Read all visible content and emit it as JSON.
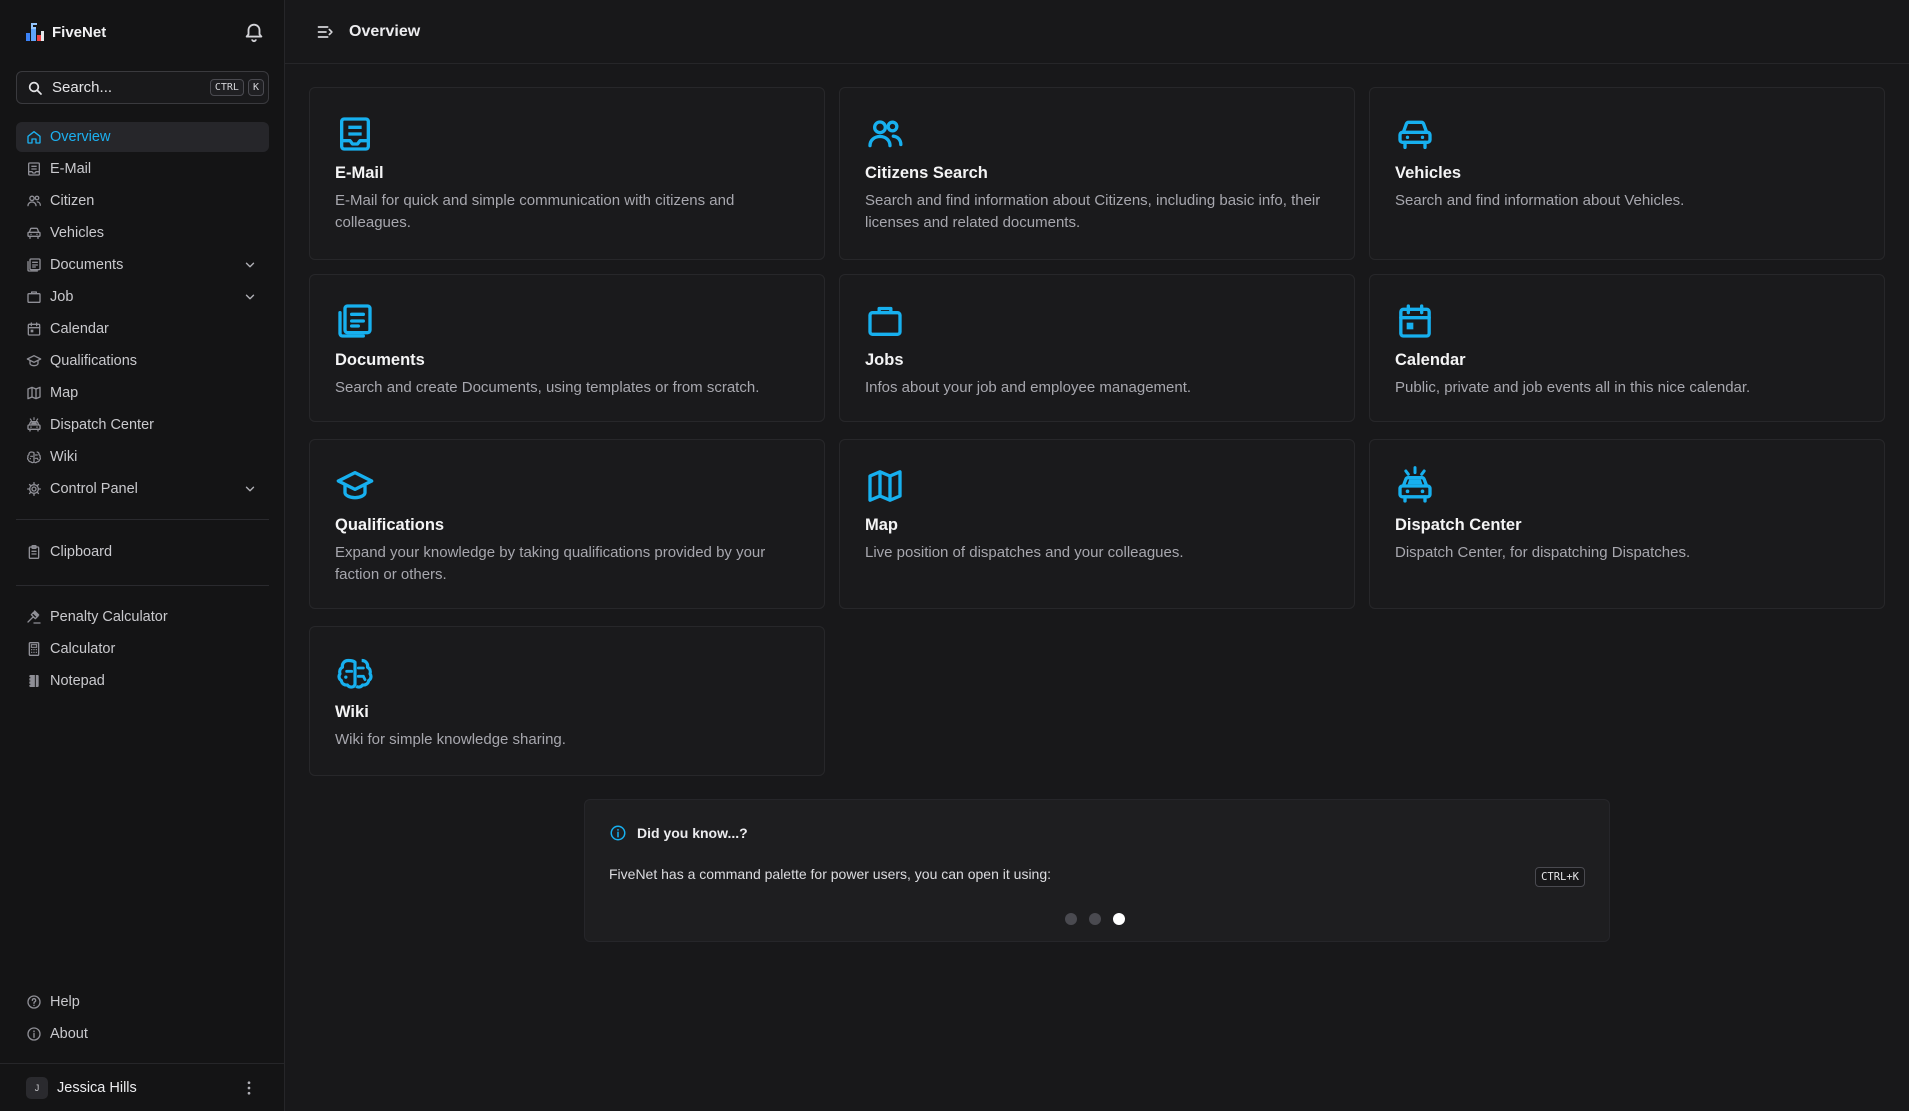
{
  "app": {
    "name": "FiveNet"
  },
  "search": {
    "placeholder": "Search...",
    "kbd_ctrl": "CTRL",
    "kbd_key": "K"
  },
  "sidebar": {
    "items": [
      {
        "label": "Overview",
        "icon": "home-icon",
        "active": true
      },
      {
        "label": "E-Mail",
        "icon": "email-icon"
      },
      {
        "label": "Citizen",
        "icon": "users-icon"
      },
      {
        "label": "Vehicles",
        "icon": "car-icon"
      },
      {
        "label": "Documents",
        "icon": "documents-icon",
        "expandable": true
      },
      {
        "label": "Job",
        "icon": "briefcase-icon",
        "expandable": true
      },
      {
        "label": "Calendar",
        "icon": "calendar-icon"
      },
      {
        "label": "Qualifications",
        "icon": "graduation-cap-icon"
      },
      {
        "label": "Map",
        "icon": "map-icon"
      },
      {
        "label": "Dispatch Center",
        "icon": "car-emergency-icon"
      },
      {
        "label": "Wiki",
        "icon": "brain-icon"
      },
      {
        "label": "Control Panel",
        "icon": "gear-icon",
        "expandable": true
      }
    ],
    "clipboard": {
      "label": "Clipboard",
      "icon": "clipboard-icon"
    },
    "tools": [
      {
        "label": "Penalty Calculator",
        "icon": "gavel-icon"
      },
      {
        "label": "Calculator",
        "icon": "calculator-icon"
      },
      {
        "label": "Notepad",
        "icon": "notebook-icon"
      }
    ],
    "bottom": [
      {
        "label": "Help",
        "icon": "help-icon"
      },
      {
        "label": "About",
        "icon": "info-icon"
      }
    ]
  },
  "user": {
    "initial": "J",
    "name": "Jessica Hills"
  },
  "header": {
    "title": "Overview"
  },
  "cards": [
    {
      "title": "E-Mail",
      "desc": "E-Mail for quick and simple communication with citizens and colleagues.",
      "icon": "email-icon"
    },
    {
      "title": "Citizens Search",
      "desc": "Search and find information about Citizens, including basic info, their licenses and related documents.",
      "icon": "users-icon"
    },
    {
      "title": "Vehicles",
      "desc": "Search and find information about Vehicles.",
      "icon": "car-icon"
    },
    {
      "title": "Documents",
      "desc": "Search and create Documents, using templates or from scratch.",
      "icon": "documents-icon"
    },
    {
      "title": "Jobs",
      "desc": "Infos about your job and employee management.",
      "icon": "briefcase-icon"
    },
    {
      "title": "Calendar",
      "desc": "Public, private and job events all in this nice calendar.",
      "icon": "calendar-icon"
    },
    {
      "title": "Qualifications",
      "desc": "Expand your knowledge by taking qualifications provided by your faction or others.",
      "icon": "graduation-cap-icon"
    },
    {
      "title": "Map",
      "desc": "Live position of dispatches and your colleagues.",
      "icon": "map-icon"
    },
    {
      "title": "Dispatch Center",
      "desc": "Dispatch Center, for dispatching Dispatches.",
      "icon": "car-emergency-icon"
    },
    {
      "title": "Wiki",
      "desc": "Wiki for simple knowledge sharing.",
      "icon": "brain-icon"
    }
  ],
  "tip": {
    "title": "Did you know...?",
    "text": "FiveNet has a command palette for power users, you can open it using:",
    "kbd": "CTRL+K",
    "slides": 3,
    "active_slide": 3
  },
  "colors": {
    "accent": "#17b0ef",
    "background": "#18181a",
    "sidebar": "#141415"
  }
}
